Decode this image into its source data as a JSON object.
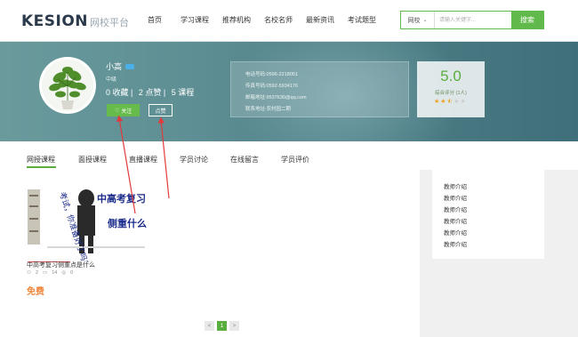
{
  "header": {
    "logo_main": "KESION",
    "logo_sub": "网校平台",
    "nav": [
      "首页",
      "学习课程",
      "推荐机构",
      "名校名师",
      "最新资讯",
      "考试题型"
    ],
    "search": {
      "category": "网校",
      "placeholder": "请输入关键字...",
      "button": "搜索"
    }
  },
  "profile": {
    "name": "小高",
    "level": "中级",
    "stats": [
      "0 收藏 |",
      "2 点赞 |",
      "5 课程"
    ],
    "follow_label": "关注",
    "like_label": "点赞",
    "contact": [
      "电话号码:0596-2218051",
      "传真号码:0592-5934176",
      "邮箱地址:9537630@qq.com",
      "联系地址:农村园二期"
    ],
    "score": {
      "value": "5.0",
      "label": "综合评分 (1人)",
      "stars_filled": 2.5,
      "stars_total": 5
    }
  },
  "tabs": [
    "网授课程",
    "面授课程",
    "直播课程",
    "学员讨论",
    "在线留言",
    "学员评价"
  ],
  "course": {
    "title": "中高考复习侧重点是什么",
    "meta": [
      "2",
      "14",
      "0"
    ],
    "price": "免费",
    "thumb_text_1": "中高考复习",
    "thumb_text_2": "侧重什么",
    "thumb_text_left": "考试，你准备好了吗？"
  },
  "pagination": {
    "prev": "<",
    "current": "1",
    "next": ">"
  },
  "side": {
    "items": [
      "教师介绍",
      "教师介绍",
      "教师介绍",
      "教师介绍",
      "教师介绍",
      "教师介绍"
    ]
  },
  "colors": {
    "accent": "#5aae3e",
    "price": "#f0883c",
    "annotation": "#e23a3a"
  }
}
